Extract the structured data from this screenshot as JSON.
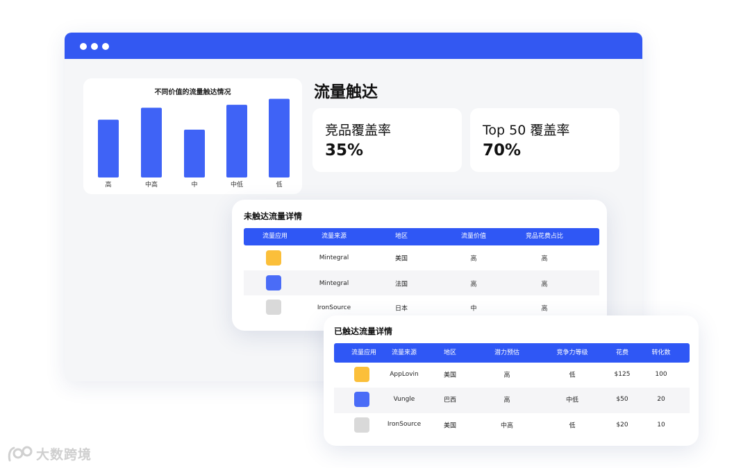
{
  "colors": {
    "accent": "#3358f2",
    "header": "#2f57f5",
    "bar": "#3f63f6",
    "yellow": "#fbbf3a",
    "blue": "#4a6cf7",
    "gray": "#d9d9d9"
  },
  "chart_data": {
    "type": "bar",
    "title": "不同价值的流量触达情况",
    "categories": [
      "高",
      "中高",
      "中",
      "中低",
      "低"
    ],
    "values": [
      58,
      70,
      48,
      73,
      79
    ],
    "ylim": [
      0,
      80
    ],
    "grid": false,
    "legend": "none"
  },
  "main": {
    "section_title": "流量触达",
    "stats": [
      {
        "label": "竞品覆盖率",
        "value": "35%"
      },
      {
        "label": "Top 50 覆盖率",
        "value": "70%"
      }
    ]
  },
  "untouched": {
    "title": "未触达流量详情",
    "columns": [
      "流量应用",
      "流量来源",
      "地区",
      "流量价值",
      "竞品花费占比"
    ],
    "rows": [
      {
        "icon_color": "yellow",
        "source": "Mintegral",
        "region": "美国",
        "value": "高",
        "share": "高"
      },
      {
        "icon_color": "blue",
        "source": "Mintegral",
        "region": "法国",
        "value": "高",
        "share": "高"
      },
      {
        "icon_color": "gray",
        "source": "IronSource",
        "region": "日本",
        "value": "中",
        "share": "高"
      }
    ]
  },
  "touched": {
    "title": "已触达流量详情",
    "columns": [
      "流量应用",
      "流量来源",
      "地区",
      "潜力预估",
      "竞争力等级",
      "花费",
      "转化数"
    ],
    "rows": [
      {
        "icon_color": "yellow",
        "source": "AppLovin",
        "region": "美国",
        "potential": "高",
        "competition": "低",
        "spend": "$125",
        "conversions": "100"
      },
      {
        "icon_color": "blue",
        "source": "Vungle",
        "region": "巴西",
        "potential": "高",
        "competition": "中低",
        "spend": "$50",
        "conversions": "20"
      },
      {
        "icon_color": "gray",
        "source": "IronSource",
        "region": "美国",
        "potential": "中高",
        "competition": "低",
        "spend": "$20",
        "conversions": "10"
      }
    ]
  },
  "watermark": {
    "text": "大数跨境",
    "icon": "watermark-logo-icon"
  }
}
